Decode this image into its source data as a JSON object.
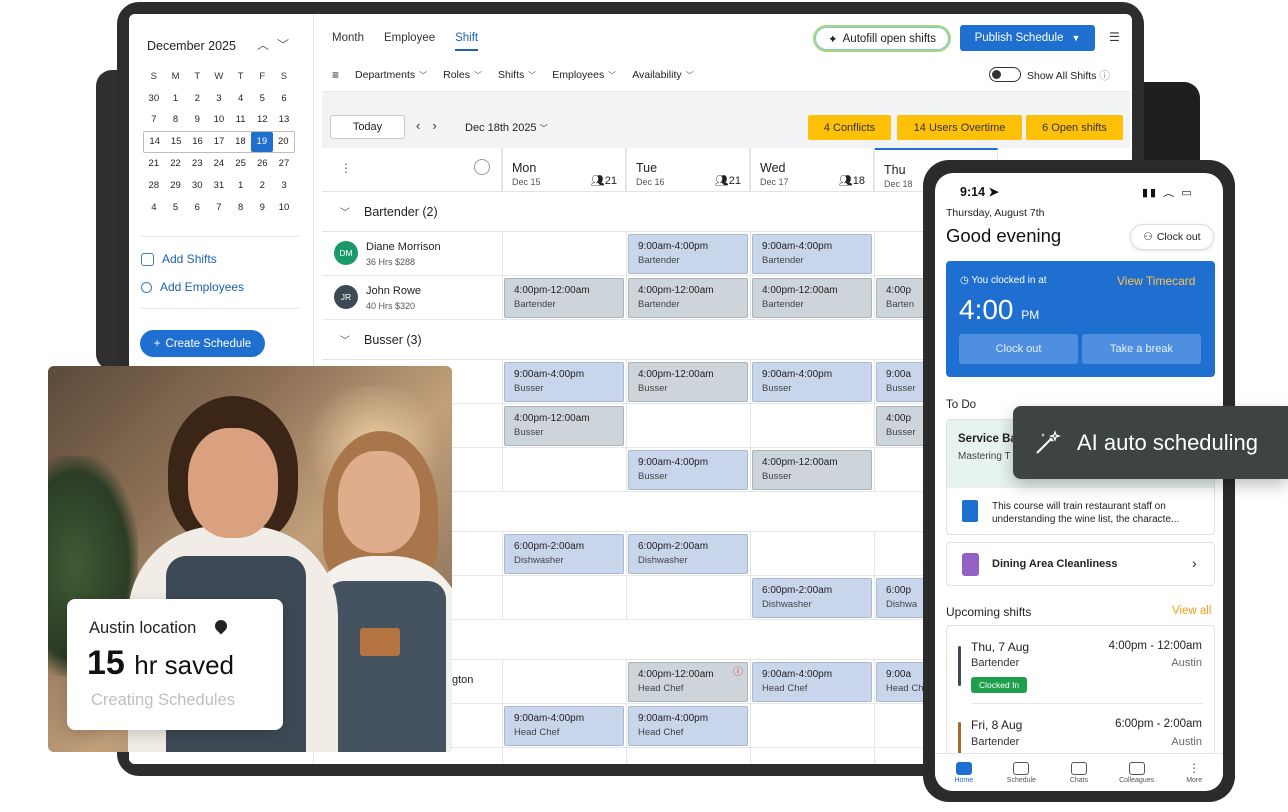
{
  "calendar": {
    "month_label": "December 2025",
    "dow": [
      "S",
      "M",
      "T",
      "W",
      "T",
      "F",
      "S"
    ],
    "weeks": [
      [
        "30",
        "1",
        "2",
        "3",
        "4",
        "5",
        "6"
      ],
      [
        "7",
        "8",
        "9",
        "10",
        "11",
        "12",
        "13"
      ],
      [
        "14",
        "15",
        "16",
        "17",
        "18",
        "19",
        "20"
      ],
      [
        "21",
        "22",
        "23",
        "24",
        "25",
        "26",
        "27"
      ],
      [
        "28",
        "29",
        "30",
        "31",
        "1",
        "2",
        "3"
      ],
      [
        "4",
        "5",
        "6",
        "7",
        "8",
        "9",
        "10"
      ]
    ],
    "selected_week_index": 2,
    "today": "19"
  },
  "sidebar": {
    "add_shifts": "Add Shifts",
    "add_employees": "Add Employees",
    "create_schedule": "Create Schedule"
  },
  "topbar": {
    "tabs": [
      "Month",
      "Employee",
      "Shift"
    ],
    "active_tab": "Shift",
    "autofill": "Autofill open shifts",
    "publish": "Publish Schedule"
  },
  "filters": {
    "items": [
      "Departments",
      "Roles",
      "Shifts",
      "Employees",
      "Availability"
    ],
    "show_all": "Show All Shifts"
  },
  "toolbar": {
    "today": "Today",
    "date": "Dec 18th 2025",
    "conflicts_count": "4",
    "conflicts_label": "Conflicts",
    "overtime_count": "14",
    "overtime_label": "Users Overtime",
    "open_count": "6",
    "open_label": "Open shifts"
  },
  "days": [
    {
      "name": "Mon",
      "date": "Dec 15",
      "count": "21"
    },
    {
      "name": "Tue",
      "date": "Dec 16",
      "count": "21"
    },
    {
      "name": "Wed",
      "date": "Dec 17",
      "count": "18"
    },
    {
      "name": "Thu",
      "date": "Dec 18",
      "count": ""
    }
  ],
  "groups": {
    "bartender": "Bartender (2)",
    "busser": "Busser (3)"
  },
  "employees": [
    {
      "initials": "DM",
      "name": "Diane Morrison",
      "meta": "36 Hrs   $288",
      "color": "#1a9a6b"
    },
    {
      "initials": "JR",
      "name": "John Rowe",
      "meta": "40 Hrs   $320",
      "color": "#3d4a55"
    }
  ],
  "partial_name": "gton",
  "shifts": {
    "t1": "9:00am-4:00pm",
    "t2": "4:00pm-12:00am",
    "t3": "6:00pm-2:00am",
    "t3b": "6:00p",
    "bartender": "Bartender",
    "busser": "Busser",
    "dishwasher": "Dishwasher",
    "headchef": "Head Chef",
    "t1short": "9:00a",
    "t2short": "4:00p",
    "bartender_short": "Barten",
    "busser_short": "Busser",
    "dishwasher_short": "Dishwa",
    "headchef_short": "Head Ch"
  },
  "photo_card": {
    "location": "Austin location",
    "hours_number": "15",
    "hours_unit": "hr saved",
    "subtitle": "Creating Schedules"
  },
  "phone": {
    "time": "9:14",
    "date": "Thursday, August 7th",
    "greeting": "Good evening",
    "clock_out_pill": "Clock out",
    "clocked_in_label": "You clocked in at",
    "view_timecard": "View Timecard",
    "clock_time": "4:00",
    "clock_ampm": "PM",
    "btn_clock_out": "Clock out",
    "btn_break": "Take a break",
    "todo": "To Do",
    "course_title": "Service Ba",
    "course_sub": "Mastering T",
    "course_desc": "This course will train restaurant staff on understanding the wine list, the characte...",
    "dining": "Dining Area Cleanliness",
    "upcoming": "Upcoming shifts",
    "view_all": "View all",
    "shifts": [
      {
        "day": "Thu, 7 Aug",
        "role": "Bartender",
        "time": "4:00pm - 12:00am",
        "loc": "Austin",
        "badge": "Clocked In",
        "bar": "#3d4a55"
      },
      {
        "day": "Fri, 8 Aug",
        "role": "Bartender",
        "time": "6:00pm - 2:00am",
        "loc": "Austin",
        "badge": "",
        "bar": "#a0692e"
      }
    ],
    "tabbar": [
      "Home",
      "Schedule",
      "Chats",
      "Colleagues",
      "More"
    ]
  },
  "ai_tooltip": "AI auto scheduling"
}
